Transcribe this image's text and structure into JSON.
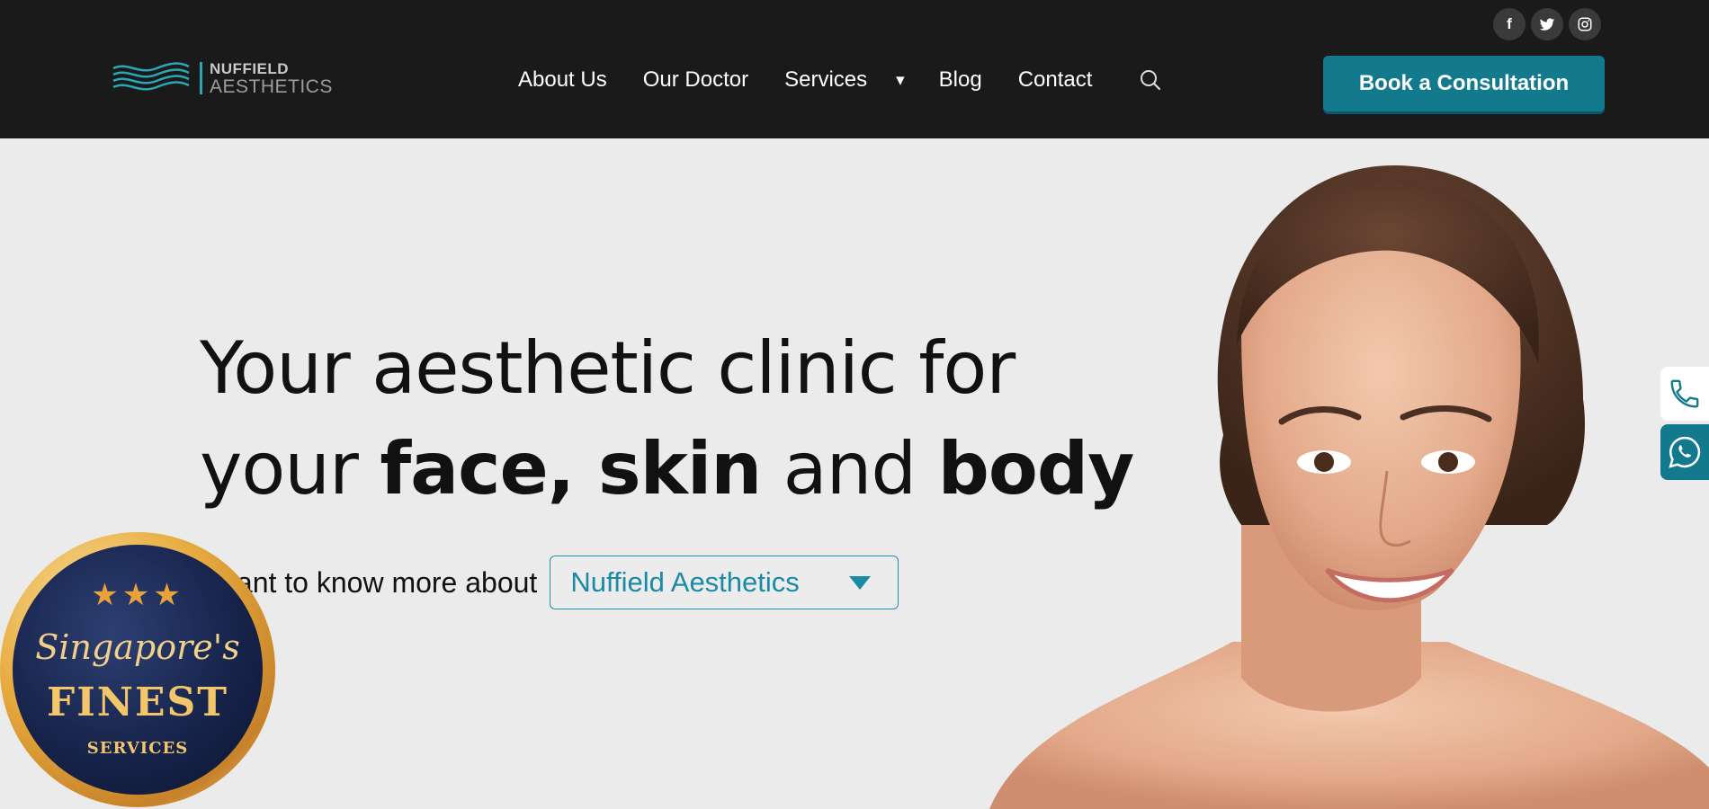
{
  "header": {
    "social": [
      {
        "name": "facebook",
        "glyph": "f"
      },
      {
        "name": "twitter",
        "glyph": ""
      },
      {
        "name": "instagram",
        "glyph": ""
      }
    ],
    "logo": {
      "line1": "NUFFIELD",
      "line2": "AESTHETICS"
    },
    "nav": {
      "items": [
        "About Us",
        "Our Doctor",
        "Services",
        "Blog",
        "Contact"
      ],
      "services_caret": "▾"
    },
    "cta_label": "Book a Consultation"
  },
  "hero": {
    "title_line1": "Your aesthetic clinic for",
    "title_line2_pre": "your ",
    "title_line2_bold1": "face, skin",
    "title_line2_mid": " and ",
    "title_line2_bold2": "body",
    "know_label": "I want to know more about",
    "dropdown_value": "Nuffield Aesthetics"
  },
  "badge": {
    "stars": "★★★",
    "script": "Singapore's",
    "finest": "FINEST",
    "services": "SERVICES"
  },
  "colors": {
    "header_bg": "#1a1a1a",
    "accent_teal": "#137a8e",
    "dropdown_text": "#1a8aa5",
    "page_bg": "#ebebeb",
    "badge_gold": "#e6a93c",
    "badge_navy": "#17244b"
  },
  "icons": [
    "facebook-icon",
    "twitter-icon",
    "instagram-icon",
    "search-icon",
    "phone-icon",
    "whatsapp-icon",
    "dropdown-arrow-icon",
    "logo-waves-icon"
  ]
}
